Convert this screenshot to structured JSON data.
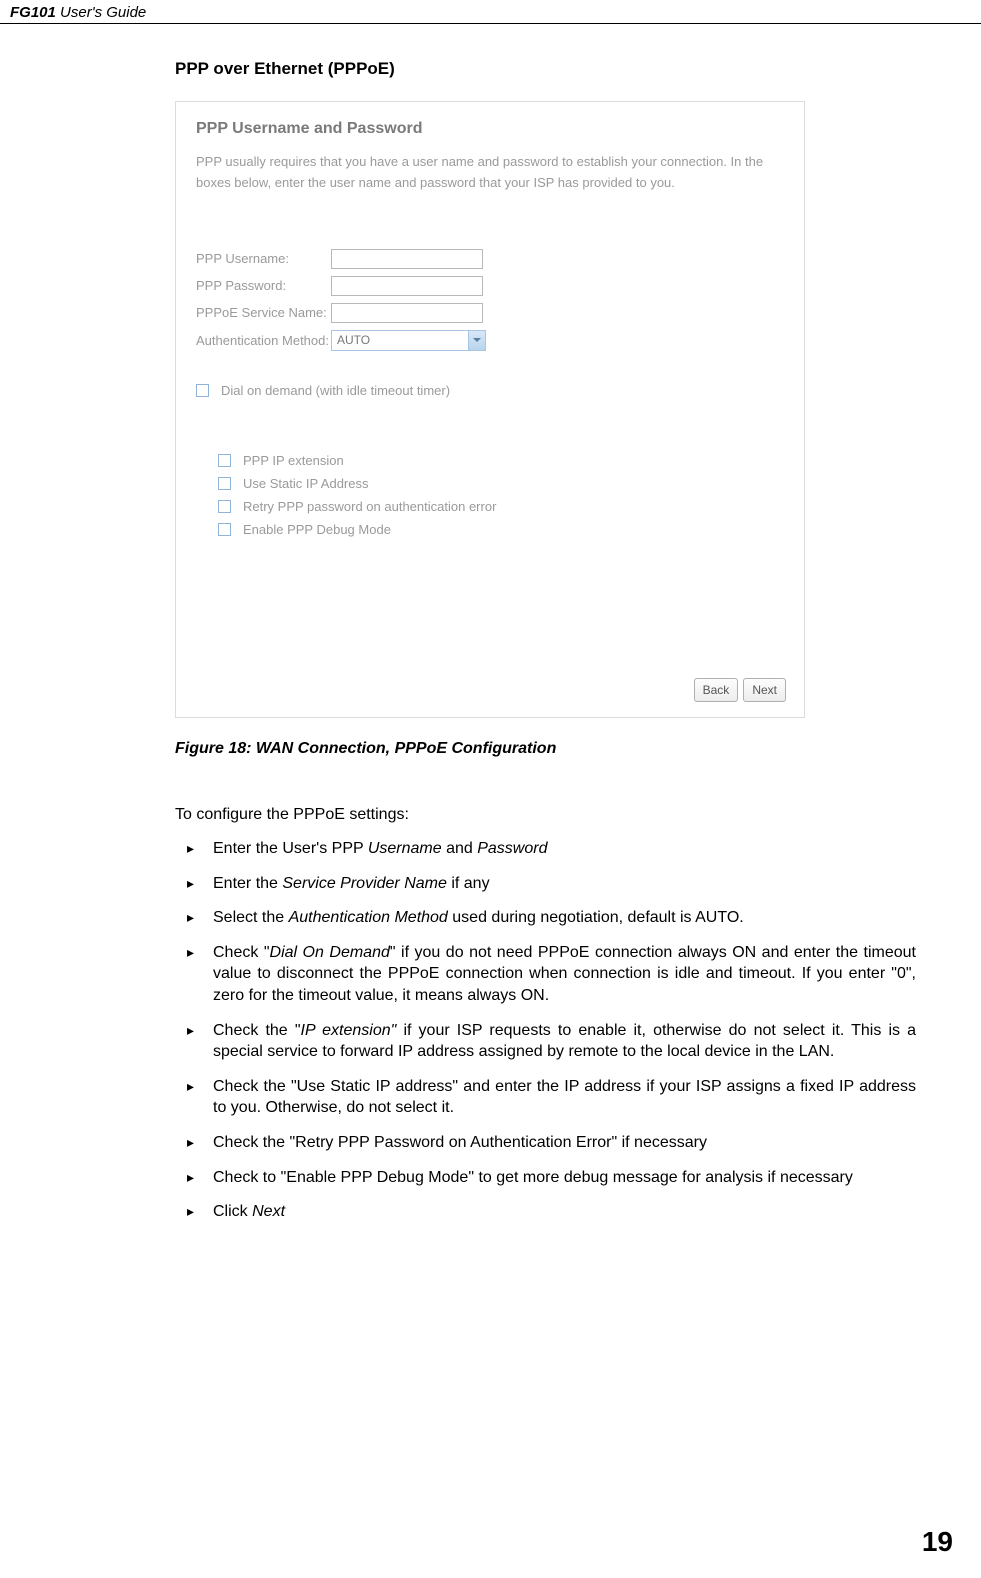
{
  "header": {
    "model": "FG101",
    "guide": "User's Guide"
  },
  "section": {
    "title": "PPP over Ethernet (PPPoE)"
  },
  "screenshot": {
    "title": "PPP Username and Password",
    "description": "PPP usually requires that you have a user name and password to establish your connection. In the boxes below, enter the user name and password that your ISP has provided to you.",
    "fields": {
      "username": "PPP Username:",
      "password": "PPP Password:",
      "service": "PPPoE Service Name:",
      "auth": "Authentication Method:",
      "auth_value": "AUTO"
    },
    "checkboxes": {
      "dial": "Dial on demand (with idle timeout timer)",
      "ext": "PPP IP extension",
      "static": "Use Static IP Address",
      "retry": "Retry PPP password on authentication error",
      "debug": "Enable PPP Debug Mode"
    },
    "buttons": {
      "back": "Back",
      "next": "Next"
    }
  },
  "figure": {
    "caption": "Figure 18: WAN Connection, PPPoE Configuration"
  },
  "instructions": {
    "intro": "To configure the PPPoE settings:",
    "items": [
      {
        "pre": "Enter the User's PPP ",
        "i1": "Username",
        "mid": " and ",
        "i2": "Password"
      },
      {
        "pre": "Enter the ",
        "i1": "Service Provider Name",
        "post": " if any"
      },
      {
        "pre": "Select the ",
        "i1": "Authentication Method",
        "post": " used during negotiation, default is AUTO."
      },
      {
        "pre": "Check \"",
        "i1": "Dial On Demand",
        "post": "\" if you do not need PPPoE connection always ON and enter the timeout value to disconnect the PPPoE connection when connection is idle and timeout. If you enter \"0\", zero for the timeout value, it means always ON."
      },
      {
        "pre": "Check the \"",
        "i1": "IP extension\"",
        "post": " if your ISP requests to enable it, otherwise do not select it. This is a special service to forward IP address assigned by remote to the local device in the LAN."
      },
      {
        "text": "Check the \"Use Static IP address\" and enter the IP address if your ISP assigns a fixed IP address to you. Otherwise, do not select it."
      },
      {
        "text": "Check the \"Retry PPP Password on Authentication Error\" if necessary"
      },
      {
        "text": "Check to \"Enable PPP Debug Mode\" to get more debug message for analysis if necessary"
      },
      {
        "pre": "Click ",
        "i1": "Next"
      }
    ]
  },
  "page": {
    "number": "19"
  }
}
